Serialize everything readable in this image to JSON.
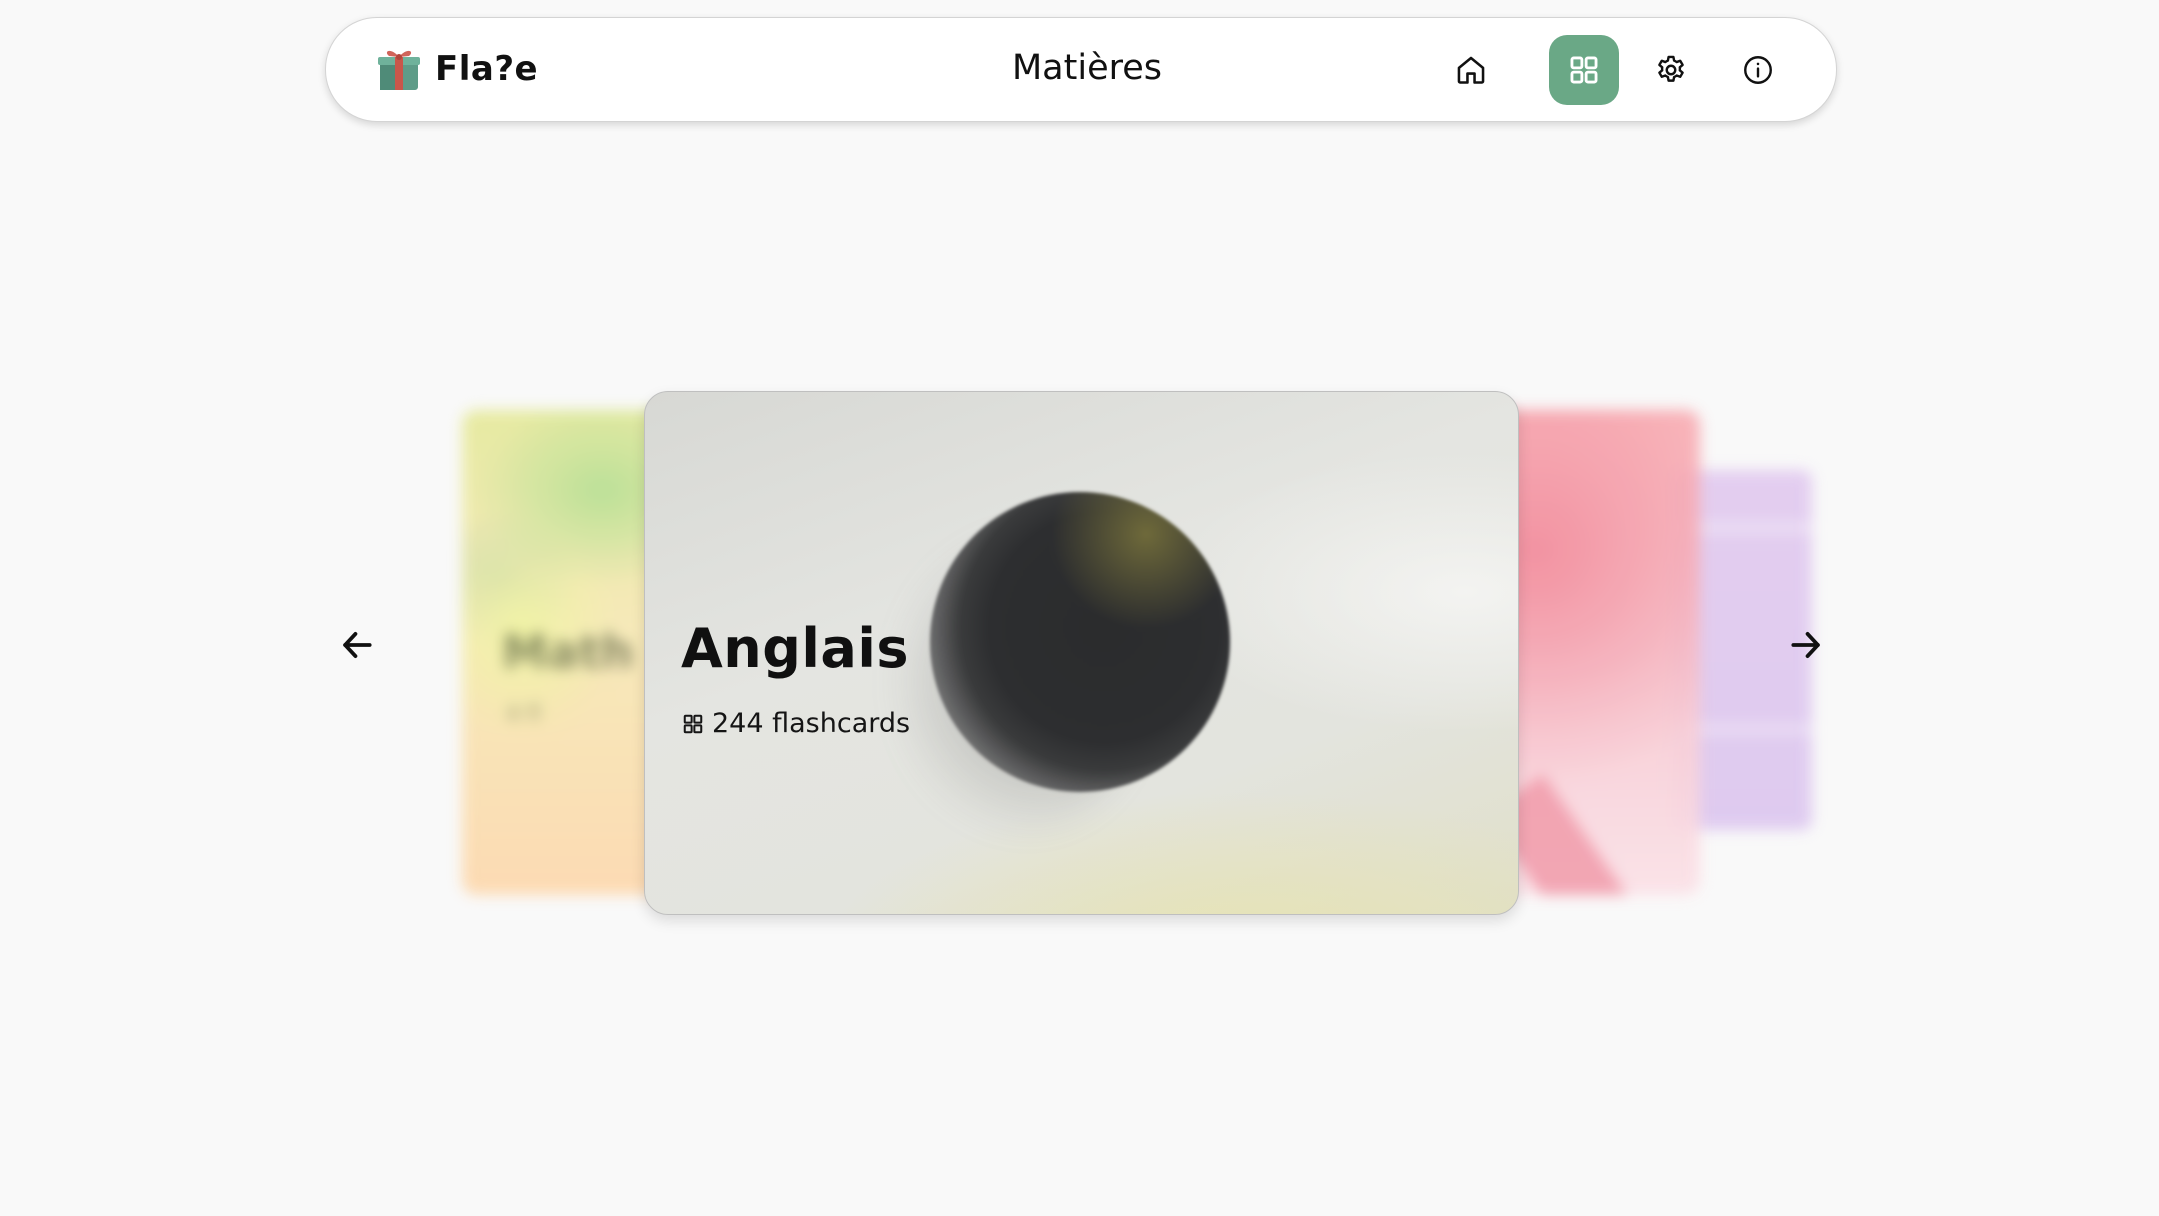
{
  "header": {
    "brand_name": "Fla?e",
    "logo_icon": "gift-box-icon",
    "page_title": "Matières",
    "nav": [
      {
        "icon": "home-icon",
        "active": false
      },
      {
        "icon": "grid-icon",
        "active": true
      },
      {
        "icon": "gear-icon",
        "active": false
      },
      {
        "icon": "info-icon",
        "active": false
      }
    ],
    "active_color": "#6aa886"
  },
  "carousel": {
    "current": {
      "title": "Anglais",
      "count_label": "244 flashcards",
      "icon": "grid-icon"
    },
    "previous": {
      "title": "Math",
      "count_label": "4 fl"
    },
    "prev_icon": "arrow-left-icon",
    "next_icon": "arrow-right-icon"
  }
}
